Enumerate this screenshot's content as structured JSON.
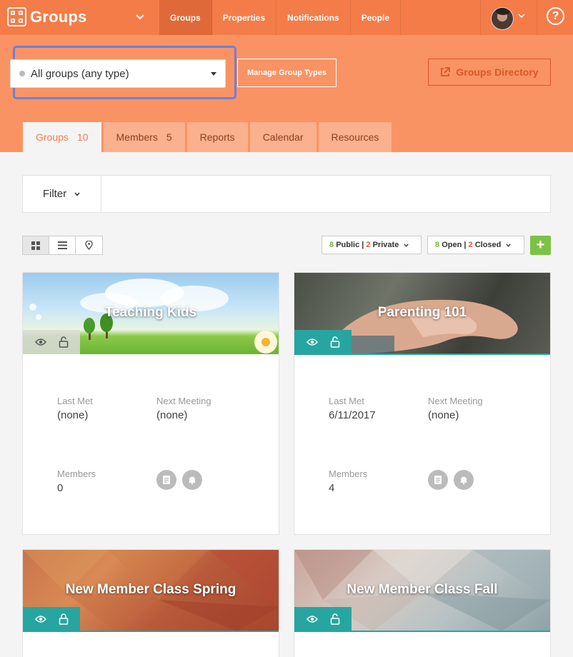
{
  "app": {
    "name": "Groups"
  },
  "nav": [
    "Groups",
    "Properties",
    "Notifications",
    "People"
  ],
  "help_label": "?",
  "select": {
    "value": "All groups (any type)"
  },
  "manage_group_types": "Manage Group Types",
  "groups_directory": "Groups Directory",
  "tabs": [
    {
      "label": "Groups",
      "count": "10"
    },
    {
      "label": "Members",
      "count": "5"
    },
    {
      "label": "Reports"
    },
    {
      "label": "Calendar"
    },
    {
      "label": "Resources"
    }
  ],
  "filter": {
    "label": "Filter",
    "value": ""
  },
  "privacy": {
    "public_count": "8",
    "public_label": "Public",
    "private_count": "2",
    "private_label": "Private"
  },
  "openness": {
    "open_count": "8",
    "open_label": "Open",
    "closed_count": "2",
    "closed_label": "Closed"
  },
  "add_label": "+",
  "labels": {
    "last_met": "Last Met",
    "next_meeting": "Next Meeting",
    "members": "Members"
  },
  "cards": [
    {
      "title": "Teaching Kids",
      "last_met": "(none)",
      "next_meeting": "(none)",
      "members": "0"
    },
    {
      "title": "Parenting 101",
      "last_met": "6/11/2017",
      "next_meeting": "(none)",
      "members": "4"
    },
    {
      "title": "New Member Class Spring"
    },
    {
      "title": "New Member Class Fall"
    }
  ],
  "colors": {
    "brand": "#f47c48",
    "band": "#fa9363",
    "teal": "#27a5a0",
    "green": "#7cc243"
  }
}
